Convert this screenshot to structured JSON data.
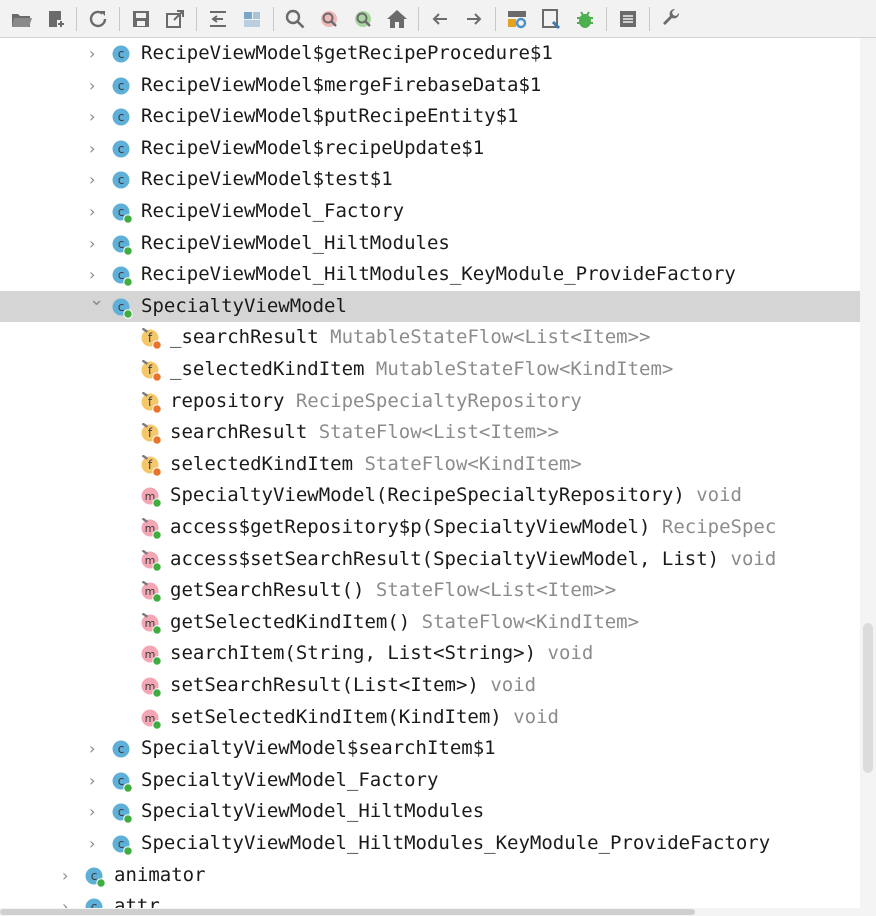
{
  "toolbar": {
    "buttons": [
      {
        "name": "open-folder-icon"
      },
      {
        "name": "add-file-icon"
      },
      {
        "sep": true
      },
      {
        "name": "refresh-icon"
      },
      {
        "sep": true
      },
      {
        "name": "save-icon"
      },
      {
        "name": "export-icon"
      },
      {
        "sep": true
      },
      {
        "name": "collapse-icon"
      },
      {
        "name": "module-icon"
      },
      {
        "sep": true
      },
      {
        "name": "search-icon"
      },
      {
        "name": "find-usages-icon"
      },
      {
        "name": "find-green-icon"
      },
      {
        "name": "home-icon"
      },
      {
        "sep": true
      },
      {
        "name": "back-arrow-icon"
      },
      {
        "name": "forward-arrow-icon"
      },
      {
        "sep": true
      },
      {
        "name": "settings-network-icon"
      },
      {
        "name": "bookmark-icon"
      },
      {
        "name": "bug-icon"
      },
      {
        "sep": true
      },
      {
        "name": "list-icon"
      },
      {
        "sep": true
      },
      {
        "name": "wrench-icon"
      }
    ]
  },
  "tree": {
    "rows": [
      {
        "indent": 1,
        "arrow": "collapsed",
        "icon": "class",
        "label": "RecipeViewModel$getRecipeProcedure$1"
      },
      {
        "indent": 1,
        "arrow": "collapsed",
        "icon": "class",
        "label": "RecipeViewModel$mergeFirebaseData$1"
      },
      {
        "indent": 1,
        "arrow": "collapsed",
        "icon": "class",
        "label": "RecipeViewModel$putRecipeEntity$1"
      },
      {
        "indent": 1,
        "arrow": "collapsed",
        "icon": "class",
        "label": "RecipeViewModel$recipeUpdate$1"
      },
      {
        "indent": 1,
        "arrow": "collapsed",
        "icon": "class",
        "label": "RecipeViewModel$test$1"
      },
      {
        "indent": 1,
        "arrow": "collapsed",
        "icon": "class-public",
        "label": "RecipeViewModel_Factory"
      },
      {
        "indent": 1,
        "arrow": "collapsed",
        "icon": "class-public",
        "label": "RecipeViewModel_HiltModules"
      },
      {
        "indent": 1,
        "arrow": "collapsed",
        "icon": "class-public",
        "label": "RecipeViewModel_HiltModules_KeyModule_ProvideFactory"
      },
      {
        "indent": 1,
        "arrow": "expanded",
        "icon": "class-public",
        "label": "SpecialtyViewModel",
        "selected": true
      },
      {
        "indent": 2,
        "icon": "field-private",
        "label": "_searchResult",
        "type": "MutableStateFlow<List<Item>>"
      },
      {
        "indent": 2,
        "icon": "field-private",
        "label": "_selectedKindItem",
        "type": "MutableStateFlow<KindItem>"
      },
      {
        "indent": 2,
        "icon": "field-private",
        "label": "repository",
        "type": "RecipeSpecialtyRepository"
      },
      {
        "indent": 2,
        "icon": "field-private",
        "label": "searchResult",
        "type": "StateFlow<List<Item>>"
      },
      {
        "indent": 2,
        "icon": "field-private",
        "label": "selectedKindItem",
        "type": "StateFlow<KindItem>"
      },
      {
        "indent": 2,
        "icon": "method-public",
        "label": "SpecialtyViewModel(RecipeSpecialtyRepository)",
        "type": "void"
      },
      {
        "indent": 2,
        "icon": "method-static",
        "label": "access$getRepository$p(SpecialtyViewModel)",
        "type": "RecipeSpec"
      },
      {
        "indent": 2,
        "icon": "method-static",
        "label": "access$setSearchResult(SpecialtyViewModel, List)",
        "type": "void"
      },
      {
        "indent": 2,
        "icon": "method-static",
        "label": "getSearchResult()",
        "type": "StateFlow<List<Item>>"
      },
      {
        "indent": 2,
        "icon": "method-static",
        "label": "getSelectedKindItem()",
        "type": "StateFlow<KindItem>"
      },
      {
        "indent": 2,
        "icon": "method-public",
        "label": "searchItem(String, List<String>)",
        "type": "void"
      },
      {
        "indent": 2,
        "icon": "method-public",
        "label": "setSearchResult(List<Item>)",
        "type": "void"
      },
      {
        "indent": 2,
        "icon": "method-public",
        "label": "setSelectedKindItem(KindItem)",
        "type": "void"
      },
      {
        "indent": 1,
        "arrow": "collapsed",
        "icon": "class",
        "label": "SpecialtyViewModel$searchItem$1"
      },
      {
        "indent": 1,
        "arrow": "collapsed",
        "icon": "class-public",
        "label": "SpecialtyViewModel_Factory"
      },
      {
        "indent": 1,
        "arrow": "collapsed",
        "icon": "class-public",
        "label": "SpecialtyViewModel_HiltModules"
      },
      {
        "indent": 1,
        "arrow": "collapsed",
        "icon": "class-public",
        "label": "SpecialtyViewModel_HiltModules_KeyModule_ProvideFactory"
      },
      {
        "indent": 0,
        "arrow": "collapsed",
        "icon": "class-public",
        "label": "animator"
      },
      {
        "indent": 0,
        "arrow": "collapsed",
        "icon": "class-public",
        "label": "attr"
      }
    ]
  },
  "colors": {
    "class_icon": "#5fb0d8",
    "field_icon": "#f5c76a",
    "method_icon": "#f4a6b4",
    "public_dot": "#3fae3f",
    "private_dot": "#e8742a",
    "selection": "#d5d5d5",
    "type_text": "#8c8c8c"
  }
}
